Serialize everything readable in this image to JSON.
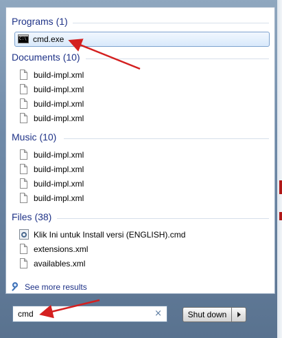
{
  "groups": {
    "programs": {
      "header": "Programs (1)",
      "items": [
        {
          "label": "cmd.exe",
          "icon": "cmd-icon"
        }
      ]
    },
    "documents": {
      "header": "Documents (10)",
      "items": [
        {
          "label": "build-impl.xml",
          "icon": "document-icon"
        },
        {
          "label": "build-impl.xml",
          "icon": "document-icon"
        },
        {
          "label": "build-impl.xml",
          "icon": "document-icon"
        },
        {
          "label": "build-impl.xml",
          "icon": "document-icon"
        }
      ]
    },
    "music": {
      "header": "Music (10)",
      "items": [
        {
          "label": "build-impl.xml",
          "icon": "document-icon"
        },
        {
          "label": "build-impl.xml",
          "icon": "document-icon"
        },
        {
          "label": "build-impl.xml",
          "icon": "document-icon"
        },
        {
          "label": "build-impl.xml",
          "icon": "document-icon"
        }
      ]
    },
    "files": {
      "header": "Files (38)",
      "items": [
        {
          "label": "Klik Ini untuk Install versi (ENGLISH).cmd",
          "icon": "setup-file-icon"
        },
        {
          "label": "extensions.xml",
          "icon": "document-icon"
        },
        {
          "label": "availables.xml",
          "icon": "document-icon"
        }
      ]
    }
  },
  "see_more_label": "See more results",
  "search": {
    "value": "cmd",
    "clear_glyph": "×"
  },
  "shutdown": {
    "label": "Shut down"
  },
  "colors": {
    "header_text": "#1e3287",
    "annotation_arrow": "#d42020",
    "selected_border": "#7da2ce"
  }
}
